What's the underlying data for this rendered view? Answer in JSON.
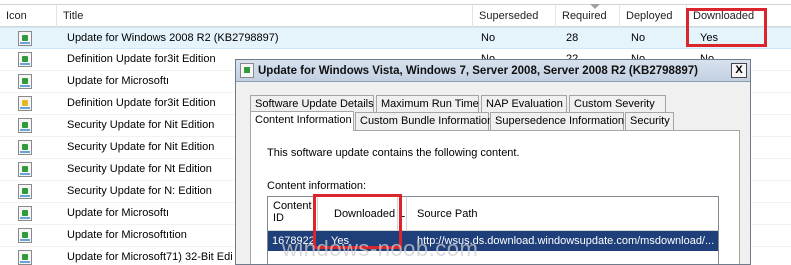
{
  "list": {
    "columns": [
      "Icon",
      "Title",
      "Superseded",
      "Required",
      "Deployed",
      "Downloaded"
    ],
    "rows": [
      {
        "title": "Update for Windows 2008 R2 (KB2798897)",
        "superseded": "No",
        "required": "28",
        "deployed": "No",
        "downloaded": "Yes",
        "icon": "update-icon"
      },
      {
        "title": "Definition Update for3it Edition",
        "superseded": "No",
        "required": "22",
        "deployed": "No",
        "downloaded": "No",
        "icon": "update-icon"
      },
      {
        "title": "Update for Microsoftı",
        "icon": "update-icon"
      },
      {
        "title": "Definition Update for3it Edition",
        "icon": "update-star-icon"
      },
      {
        "title": "Security Update for Nit Edition",
        "icon": "update-icon"
      },
      {
        "title": "Security Update for Nit Edition",
        "icon": "update-icon"
      },
      {
        "title": "Security Update for Nt Edition",
        "icon": "update-icon"
      },
      {
        "title": "Security Update for N: Edition",
        "icon": "update-icon"
      },
      {
        "title": "Update for Microsoftı",
        "icon": "update-icon"
      },
      {
        "title": "Update for Microsoftıtion",
        "icon": "update-icon"
      },
      {
        "title": "Update for Microsoft71) 32-Bit Edi",
        "icon": "update-icon"
      }
    ]
  },
  "dialog": {
    "title": "Update for Windows Vista, Windows 7, Server 2008, Server 2008 R2 (KB2798897)",
    "close_label": "X",
    "tabs_row1": [
      "Software Update Details",
      "Maximum Run Time",
      "NAP Evaluation",
      "Custom Severity"
    ],
    "tabs_row2": [
      "Content Information",
      "Custom Bundle Information",
      "Supersedence Information",
      "Security"
    ],
    "active_tab": "Content Information",
    "intro_text": "This software update contains the following content.",
    "content_label": "Content information:",
    "grid": {
      "columns": [
        "Content ID",
        "Downloaded",
        "L",
        "Source Path"
      ],
      "rows": [
        {
          "content_id": "1678922",
          "downloaded": "Yes",
          "l": "",
          "source_path": "http://wsus.ds.download.windowsupdate.com/msdownload/..."
        }
      ]
    }
  },
  "watermark": "windows-noob.com",
  "colors": {
    "highlight_box": "#d9252b",
    "selected_grid_row": "#1f3f7a",
    "titlebar": "#c8d5e6"
  }
}
